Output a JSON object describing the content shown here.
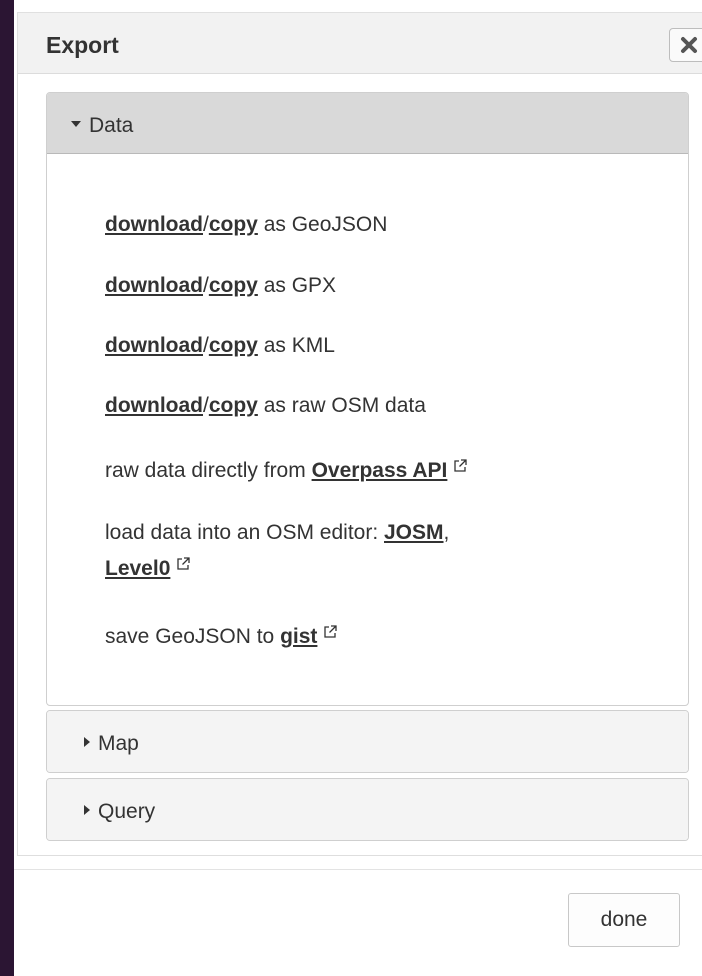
{
  "dialog": {
    "title": "Export",
    "close_icon": "close-icon",
    "done_label": "done"
  },
  "panels": {
    "data": {
      "title": "Data",
      "expanded": true,
      "lines": [
        {
          "link1": "download",
          "sep": "/",
          "link2": "copy",
          "suffix": " as GeoJSON"
        },
        {
          "link1": "download",
          "sep": "/",
          "link2": "copy",
          "suffix": " as GPX"
        },
        {
          "link1": "download",
          "sep": "/",
          "link2": "copy",
          "suffix": " as KML"
        },
        {
          "link1": "download",
          "sep": "/",
          "link2": "copy",
          "suffix": " as raw OSM data"
        }
      ],
      "overpass": {
        "prefix": "raw data directly from ",
        "link": "Overpass API"
      },
      "editor": {
        "prefix": "load data into an OSM editor: ",
        "link_josm": "JOSM",
        "comma": ",",
        "link_level0": "Level0"
      },
      "gist": {
        "prefix": "save GeoJSON to ",
        "link": "gist"
      }
    },
    "map": {
      "title": "Map",
      "expanded": false
    },
    "query": {
      "title": "Query",
      "expanded": false
    }
  },
  "colors": {
    "background": "#2b1533",
    "header_bg": "#f2f2f2",
    "active_panel_head": "#d9d9d9",
    "text": "#333333"
  }
}
